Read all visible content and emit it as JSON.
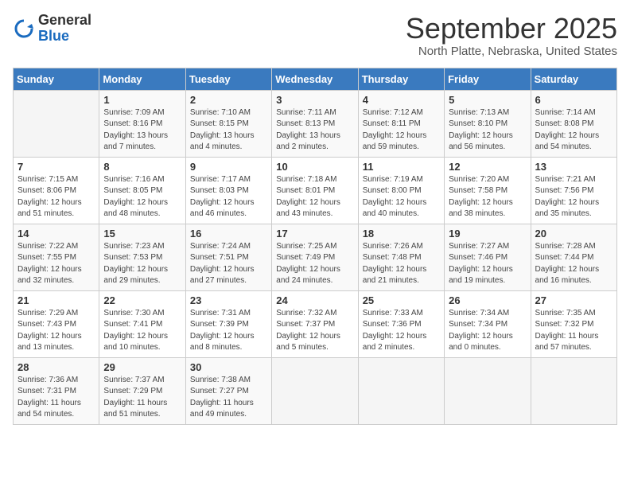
{
  "header": {
    "logo_general": "General",
    "logo_blue": "Blue",
    "month_title": "September 2025",
    "location": "North Platte, Nebraska, United States"
  },
  "weekdays": [
    "Sunday",
    "Monday",
    "Tuesday",
    "Wednesday",
    "Thursday",
    "Friday",
    "Saturday"
  ],
  "weeks": [
    [
      {
        "day": "",
        "sunrise": "",
        "sunset": "",
        "daylight": ""
      },
      {
        "day": "1",
        "sunrise": "Sunrise: 7:09 AM",
        "sunset": "Sunset: 8:16 PM",
        "daylight": "Daylight: 13 hours and 7 minutes."
      },
      {
        "day": "2",
        "sunrise": "Sunrise: 7:10 AM",
        "sunset": "Sunset: 8:15 PM",
        "daylight": "Daylight: 13 hours and 4 minutes."
      },
      {
        "day": "3",
        "sunrise": "Sunrise: 7:11 AM",
        "sunset": "Sunset: 8:13 PM",
        "daylight": "Daylight: 13 hours and 2 minutes."
      },
      {
        "day": "4",
        "sunrise": "Sunrise: 7:12 AM",
        "sunset": "Sunset: 8:11 PM",
        "daylight": "Daylight: 12 hours and 59 minutes."
      },
      {
        "day": "5",
        "sunrise": "Sunrise: 7:13 AM",
        "sunset": "Sunset: 8:10 PM",
        "daylight": "Daylight: 12 hours and 56 minutes."
      },
      {
        "day": "6",
        "sunrise": "Sunrise: 7:14 AM",
        "sunset": "Sunset: 8:08 PM",
        "daylight": "Daylight: 12 hours and 54 minutes."
      }
    ],
    [
      {
        "day": "7",
        "sunrise": "Sunrise: 7:15 AM",
        "sunset": "Sunset: 8:06 PM",
        "daylight": "Daylight: 12 hours and 51 minutes."
      },
      {
        "day": "8",
        "sunrise": "Sunrise: 7:16 AM",
        "sunset": "Sunset: 8:05 PM",
        "daylight": "Daylight: 12 hours and 48 minutes."
      },
      {
        "day": "9",
        "sunrise": "Sunrise: 7:17 AM",
        "sunset": "Sunset: 8:03 PM",
        "daylight": "Daylight: 12 hours and 46 minutes."
      },
      {
        "day": "10",
        "sunrise": "Sunrise: 7:18 AM",
        "sunset": "Sunset: 8:01 PM",
        "daylight": "Daylight: 12 hours and 43 minutes."
      },
      {
        "day": "11",
        "sunrise": "Sunrise: 7:19 AM",
        "sunset": "Sunset: 8:00 PM",
        "daylight": "Daylight: 12 hours and 40 minutes."
      },
      {
        "day": "12",
        "sunrise": "Sunrise: 7:20 AM",
        "sunset": "Sunset: 7:58 PM",
        "daylight": "Daylight: 12 hours and 38 minutes."
      },
      {
        "day": "13",
        "sunrise": "Sunrise: 7:21 AM",
        "sunset": "Sunset: 7:56 PM",
        "daylight": "Daylight: 12 hours and 35 minutes."
      }
    ],
    [
      {
        "day": "14",
        "sunrise": "Sunrise: 7:22 AM",
        "sunset": "Sunset: 7:55 PM",
        "daylight": "Daylight: 12 hours and 32 minutes."
      },
      {
        "day": "15",
        "sunrise": "Sunrise: 7:23 AM",
        "sunset": "Sunset: 7:53 PM",
        "daylight": "Daylight: 12 hours and 29 minutes."
      },
      {
        "day": "16",
        "sunrise": "Sunrise: 7:24 AM",
        "sunset": "Sunset: 7:51 PM",
        "daylight": "Daylight: 12 hours and 27 minutes."
      },
      {
        "day": "17",
        "sunrise": "Sunrise: 7:25 AM",
        "sunset": "Sunset: 7:49 PM",
        "daylight": "Daylight: 12 hours and 24 minutes."
      },
      {
        "day": "18",
        "sunrise": "Sunrise: 7:26 AM",
        "sunset": "Sunset: 7:48 PM",
        "daylight": "Daylight: 12 hours and 21 minutes."
      },
      {
        "day": "19",
        "sunrise": "Sunrise: 7:27 AM",
        "sunset": "Sunset: 7:46 PM",
        "daylight": "Daylight: 12 hours and 19 minutes."
      },
      {
        "day": "20",
        "sunrise": "Sunrise: 7:28 AM",
        "sunset": "Sunset: 7:44 PM",
        "daylight": "Daylight: 12 hours and 16 minutes."
      }
    ],
    [
      {
        "day": "21",
        "sunrise": "Sunrise: 7:29 AM",
        "sunset": "Sunset: 7:43 PM",
        "daylight": "Daylight: 12 hours and 13 minutes."
      },
      {
        "day": "22",
        "sunrise": "Sunrise: 7:30 AM",
        "sunset": "Sunset: 7:41 PM",
        "daylight": "Daylight: 12 hours and 10 minutes."
      },
      {
        "day": "23",
        "sunrise": "Sunrise: 7:31 AM",
        "sunset": "Sunset: 7:39 PM",
        "daylight": "Daylight: 12 hours and 8 minutes."
      },
      {
        "day": "24",
        "sunrise": "Sunrise: 7:32 AM",
        "sunset": "Sunset: 7:37 PM",
        "daylight": "Daylight: 12 hours and 5 minutes."
      },
      {
        "day": "25",
        "sunrise": "Sunrise: 7:33 AM",
        "sunset": "Sunset: 7:36 PM",
        "daylight": "Daylight: 12 hours and 2 minutes."
      },
      {
        "day": "26",
        "sunrise": "Sunrise: 7:34 AM",
        "sunset": "Sunset: 7:34 PM",
        "daylight": "Daylight: 12 hours and 0 minutes."
      },
      {
        "day": "27",
        "sunrise": "Sunrise: 7:35 AM",
        "sunset": "Sunset: 7:32 PM",
        "daylight": "Daylight: 11 hours and 57 minutes."
      }
    ],
    [
      {
        "day": "28",
        "sunrise": "Sunrise: 7:36 AM",
        "sunset": "Sunset: 7:31 PM",
        "daylight": "Daylight: 11 hours and 54 minutes."
      },
      {
        "day": "29",
        "sunrise": "Sunrise: 7:37 AM",
        "sunset": "Sunset: 7:29 PM",
        "daylight": "Daylight: 11 hours and 51 minutes."
      },
      {
        "day": "30",
        "sunrise": "Sunrise: 7:38 AM",
        "sunset": "Sunset: 7:27 PM",
        "daylight": "Daylight: 11 hours and 49 minutes."
      },
      {
        "day": "",
        "sunrise": "",
        "sunset": "",
        "daylight": ""
      },
      {
        "day": "",
        "sunrise": "",
        "sunset": "",
        "daylight": ""
      },
      {
        "day": "",
        "sunrise": "",
        "sunset": "",
        "daylight": ""
      },
      {
        "day": "",
        "sunrise": "",
        "sunset": "",
        "daylight": ""
      }
    ]
  ]
}
